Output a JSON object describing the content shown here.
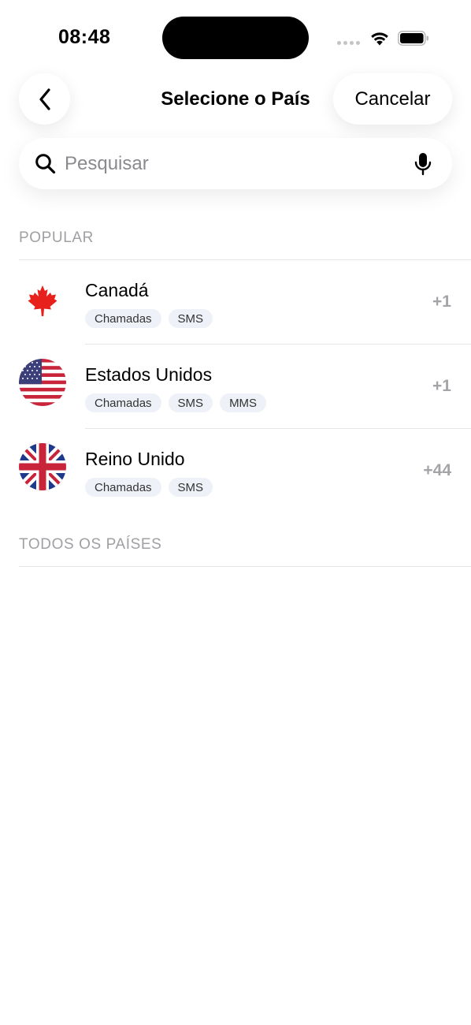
{
  "status_bar": {
    "time": "08:48"
  },
  "nav": {
    "title": "Selecione o País",
    "cancel_label": "Cancelar"
  },
  "search": {
    "placeholder": "Pesquisar",
    "value": ""
  },
  "sections": {
    "popular": "POPULAR",
    "all": "TODOS OS PAÍSES"
  },
  "countries": [
    {
      "name": "Canadá",
      "dial": "+1",
      "tags": [
        "Chamadas",
        "SMS"
      ],
      "flag_icon": "canada-flag-icon"
    },
    {
      "name": "Estados Unidos",
      "dial": "+1",
      "tags": [
        "Chamadas",
        "SMS",
        "MMS"
      ],
      "flag_icon": "usa-flag-icon"
    },
    {
      "name": "Reino Unido",
      "dial": "+44",
      "tags": [
        "Chamadas",
        "SMS"
      ],
      "flag_icon": "uk-flag-icon"
    }
  ],
  "colors": {
    "tag_bg": "#eef1f7",
    "muted_text": "#a0a0a4",
    "divider": "#e6e6e8"
  }
}
